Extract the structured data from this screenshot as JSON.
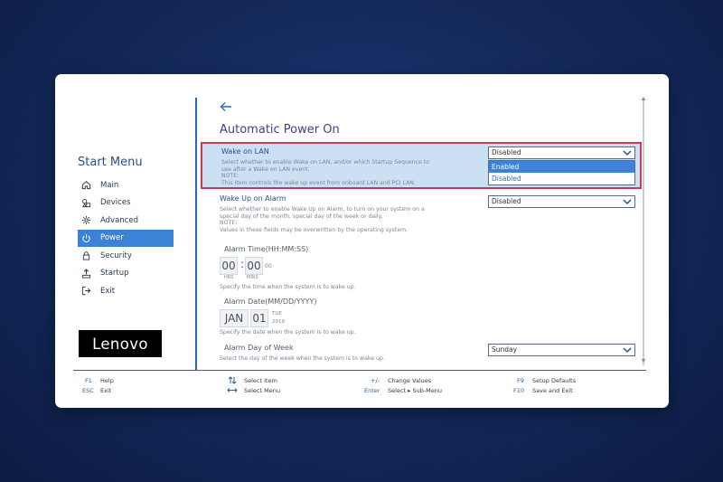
{
  "sidebar": {
    "title": "Start Menu",
    "items": [
      {
        "label": "Main",
        "icon": "home-icon"
      },
      {
        "label": "Devices",
        "icon": "devices-icon"
      },
      {
        "label": "Advanced",
        "icon": "advanced-gear-icon"
      },
      {
        "label": "Power",
        "icon": "power-icon",
        "active": true
      },
      {
        "label": "Security",
        "icon": "lock-icon"
      },
      {
        "label": "Startup",
        "icon": "startup-icon"
      },
      {
        "label": "Exit",
        "icon": "exit-icon"
      }
    ],
    "logo": "Lenovo"
  },
  "main": {
    "title": "Automatic Power On",
    "wake_on_lan": {
      "label": "Wake on LAN",
      "help_1": "Select whether to enable Wake on LAN, and/or which Startup Sequence to",
      "help_2": "use after a Wake on LAN event.",
      "help_3": "NOTE:",
      "help_4": "This item controls the wake up event from onboard LAN and PCI LAN.",
      "value": "Disabled",
      "options": [
        "Enabled",
        "Disabled"
      ],
      "highlighted_option": "Enabled"
    },
    "wake_up_on_alarm": {
      "label": "Wake Up on Alarm",
      "help_1": "Select whether to enable Wake Up on Alarm, to turn on your system on a",
      "help_2": "special day of the month, special day of the week or daily.",
      "help_3": "NOTE:",
      "help_4": "Values in these fields may be overwritten by the operating system.",
      "value": "Disabled"
    },
    "alarm_time": {
      "label": "Alarm Time(HH:MM:SS)",
      "hours": "00",
      "separator": ":",
      "minutes": "00",
      "seconds": "00",
      "hours_unit": "HRS",
      "minutes_unit": "MINS",
      "help": "Specify the time when the system is to wake up."
    },
    "alarm_date": {
      "label": "Alarm Date(MM/DD/YYYY)",
      "month": "JAN",
      "day": "01",
      "weekday": "TUE",
      "year": "2019",
      "help": "Specify the date when the system is to wake up."
    },
    "alarm_day_of_week": {
      "label": "Alarm Day of Week",
      "value": "Sunday",
      "help": "Select the day of the week when the system is to wake up."
    }
  },
  "footer": {
    "f1_key": "F1",
    "f1_desc": "Help",
    "esc_key": "ESC",
    "esc_desc": "Exit",
    "select_item": "Select Item",
    "select_menu": "Select Menu",
    "change_key": "+/-",
    "change_desc": "Change Values",
    "enter_key": "Enter",
    "enter_desc": "Select ▸ Sub-Menu",
    "f9_key": "F9",
    "f9_desc": "Setup Defaults",
    "f10_key": "F10",
    "f10_desc": "Save and Exit"
  },
  "colors": {
    "accent": "#3b82d8",
    "highlight_border": "#c83a58",
    "selected_row_bg": "#cce0f4"
  }
}
